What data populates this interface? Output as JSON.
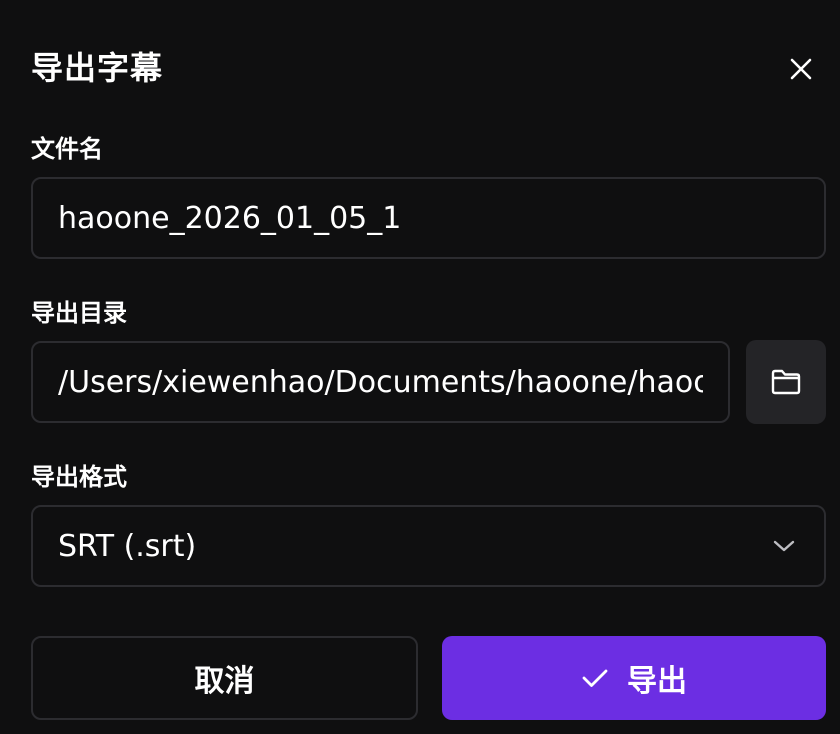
{
  "dialog": {
    "title": "导出字幕",
    "close_icon": "close-icon"
  },
  "filename": {
    "label": "文件名",
    "value": "haoone_2026_01_05_1"
  },
  "directory": {
    "label": "导出目录",
    "value": "/Users/xiewenhao/Documents/haoone/haoone",
    "browse_icon": "folder-icon"
  },
  "format": {
    "label": "导出格式",
    "selected": "SRT (.srt)",
    "icon": "chevron-down-icon"
  },
  "actions": {
    "cancel_label": "取消",
    "export_label": "导出",
    "export_icon": "check-icon",
    "accent_color": "#6c2ee3"
  }
}
